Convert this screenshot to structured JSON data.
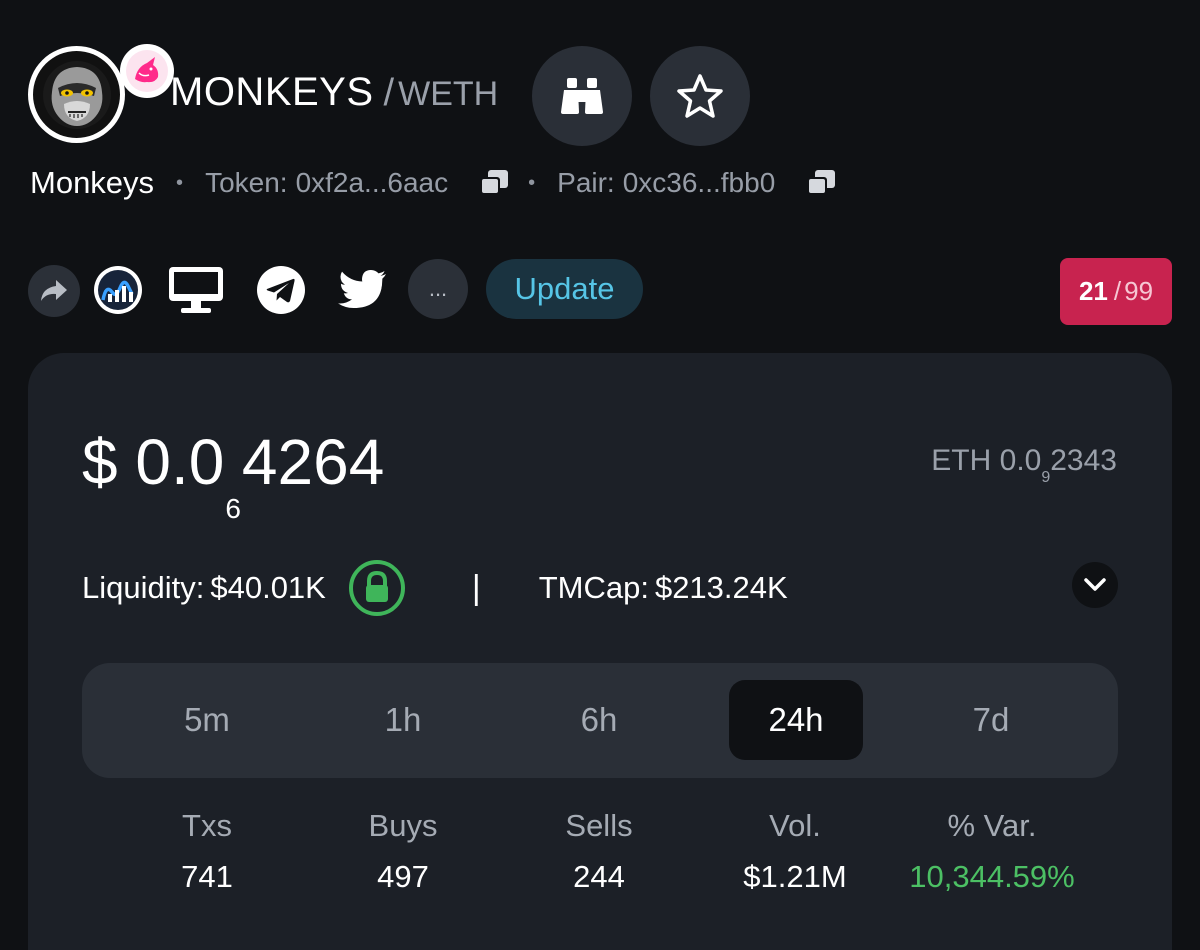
{
  "pair": {
    "base": "MONKEYS",
    "separator": "/",
    "quote": "WETH"
  },
  "token": {
    "name": "Monkeys",
    "token_label": "Token:",
    "token_address": "0xf2a...6aac",
    "pair_label": "Pair:",
    "pair_address": "0xc36...fbb0"
  },
  "actions": {
    "search_icon": "binoculars-icon",
    "watchlist_icon": "star-icon"
  },
  "links": {
    "share_icon": "share-icon",
    "items": [
      "coinmarketcap-icon",
      "website-icon",
      "telegram-icon",
      "twitter-icon"
    ],
    "more_label": "...",
    "update_label": "Update"
  },
  "score": {
    "value": "21",
    "separator": "/",
    "max": "99"
  },
  "price": {
    "usd_prefix": "$ 0.0",
    "usd_zero_count": "6",
    "usd_digits": "4264",
    "eth_prefix": "ETH 0.0",
    "eth_zero_count": "9",
    "eth_digits": "2343"
  },
  "stats": {
    "liquidity_label": "Liquidity:",
    "liquidity_value": "$40.01K",
    "divider": "|",
    "tmcap_label": "TMCap:",
    "tmcap_value": "$213.24K"
  },
  "timeframes": {
    "tabs": [
      "5m",
      "1h",
      "6h",
      "24h",
      "7d"
    ],
    "active": "24h"
  },
  "txn_stats": [
    {
      "label": "Txs",
      "value": "741"
    },
    {
      "label": "Buys",
      "value": "497"
    },
    {
      "label": "Sells",
      "value": "244"
    },
    {
      "label": "Vol.",
      "value": "$1.21M"
    },
    {
      "label": "% Var.",
      "value": "10,344.59%"
    }
  ],
  "colors": {
    "background": "#0f1114",
    "card": "#1c2027",
    "accent_cyan": "#56c5e6",
    "score_badge": "#c8234f",
    "positive": "#4cc064",
    "lock_green": "#3fb55a"
  }
}
